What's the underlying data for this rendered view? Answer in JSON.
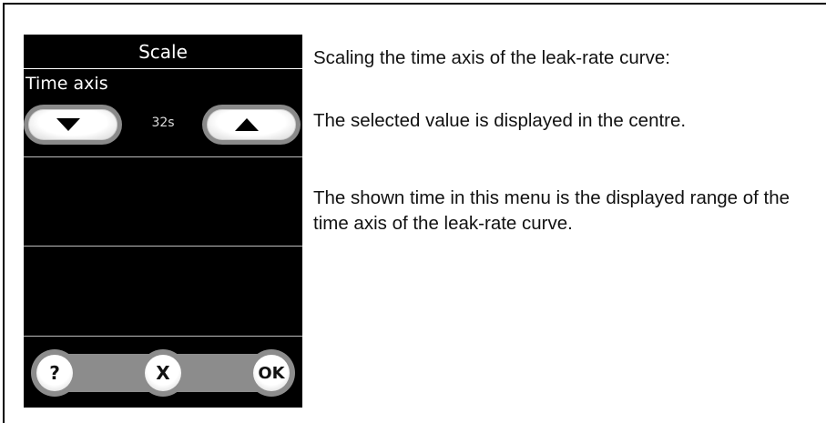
{
  "device": {
    "title": "Scale",
    "section_label": "Time axis",
    "value": "32s",
    "bottom_buttons": {
      "help": "?",
      "cancel": "X",
      "ok": "OK"
    }
  },
  "description": {
    "line1": "Scaling the time axis of the leak-rate curve:",
    "line2": "The selected value is displayed in the centre.",
    "line3": "The shown time in this menu is the displayed range of the time axis of the leak-rate curve."
  },
  "icons": {
    "decrease": "triangle-down-icon",
    "increase": "triangle-up-icon"
  }
}
